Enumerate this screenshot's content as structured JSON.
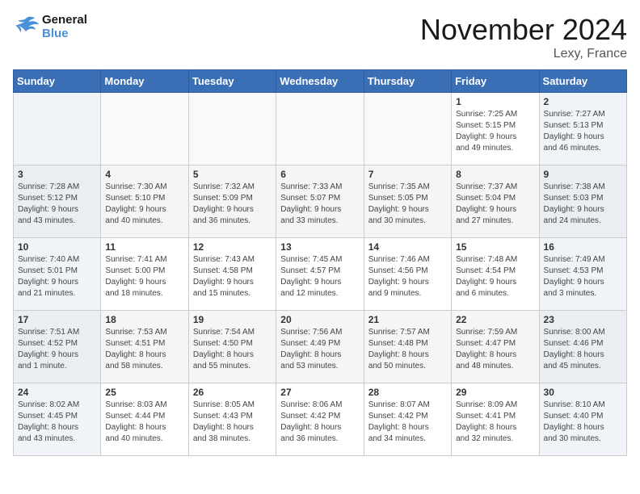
{
  "header": {
    "logo_line1": "General",
    "logo_line2": "Blue",
    "month": "November 2024",
    "location": "Lexy, France"
  },
  "days_of_week": [
    "Sunday",
    "Monday",
    "Tuesday",
    "Wednesday",
    "Thursday",
    "Friday",
    "Saturday"
  ],
  "weeks": [
    [
      {
        "day": "",
        "info": ""
      },
      {
        "day": "",
        "info": ""
      },
      {
        "day": "",
        "info": ""
      },
      {
        "day": "",
        "info": ""
      },
      {
        "day": "",
        "info": ""
      },
      {
        "day": "1",
        "info": "Sunrise: 7:25 AM\nSunset: 5:15 PM\nDaylight: 9 hours\nand 49 minutes."
      },
      {
        "day": "2",
        "info": "Sunrise: 7:27 AM\nSunset: 5:13 PM\nDaylight: 9 hours\nand 46 minutes."
      }
    ],
    [
      {
        "day": "3",
        "info": "Sunrise: 7:28 AM\nSunset: 5:12 PM\nDaylight: 9 hours\nand 43 minutes."
      },
      {
        "day": "4",
        "info": "Sunrise: 7:30 AM\nSunset: 5:10 PM\nDaylight: 9 hours\nand 40 minutes."
      },
      {
        "day": "5",
        "info": "Sunrise: 7:32 AM\nSunset: 5:09 PM\nDaylight: 9 hours\nand 36 minutes."
      },
      {
        "day": "6",
        "info": "Sunrise: 7:33 AM\nSunset: 5:07 PM\nDaylight: 9 hours\nand 33 minutes."
      },
      {
        "day": "7",
        "info": "Sunrise: 7:35 AM\nSunset: 5:05 PM\nDaylight: 9 hours\nand 30 minutes."
      },
      {
        "day": "8",
        "info": "Sunrise: 7:37 AM\nSunset: 5:04 PM\nDaylight: 9 hours\nand 27 minutes."
      },
      {
        "day": "9",
        "info": "Sunrise: 7:38 AM\nSunset: 5:03 PM\nDaylight: 9 hours\nand 24 minutes."
      }
    ],
    [
      {
        "day": "10",
        "info": "Sunrise: 7:40 AM\nSunset: 5:01 PM\nDaylight: 9 hours\nand 21 minutes."
      },
      {
        "day": "11",
        "info": "Sunrise: 7:41 AM\nSunset: 5:00 PM\nDaylight: 9 hours\nand 18 minutes."
      },
      {
        "day": "12",
        "info": "Sunrise: 7:43 AM\nSunset: 4:58 PM\nDaylight: 9 hours\nand 15 minutes."
      },
      {
        "day": "13",
        "info": "Sunrise: 7:45 AM\nSunset: 4:57 PM\nDaylight: 9 hours\nand 12 minutes."
      },
      {
        "day": "14",
        "info": "Sunrise: 7:46 AM\nSunset: 4:56 PM\nDaylight: 9 hours\nand 9 minutes."
      },
      {
        "day": "15",
        "info": "Sunrise: 7:48 AM\nSunset: 4:54 PM\nDaylight: 9 hours\nand 6 minutes."
      },
      {
        "day": "16",
        "info": "Sunrise: 7:49 AM\nSunset: 4:53 PM\nDaylight: 9 hours\nand 3 minutes."
      }
    ],
    [
      {
        "day": "17",
        "info": "Sunrise: 7:51 AM\nSunset: 4:52 PM\nDaylight: 9 hours\nand 1 minute."
      },
      {
        "day": "18",
        "info": "Sunrise: 7:53 AM\nSunset: 4:51 PM\nDaylight: 8 hours\nand 58 minutes."
      },
      {
        "day": "19",
        "info": "Sunrise: 7:54 AM\nSunset: 4:50 PM\nDaylight: 8 hours\nand 55 minutes."
      },
      {
        "day": "20",
        "info": "Sunrise: 7:56 AM\nSunset: 4:49 PM\nDaylight: 8 hours\nand 53 minutes."
      },
      {
        "day": "21",
        "info": "Sunrise: 7:57 AM\nSunset: 4:48 PM\nDaylight: 8 hours\nand 50 minutes."
      },
      {
        "day": "22",
        "info": "Sunrise: 7:59 AM\nSunset: 4:47 PM\nDaylight: 8 hours\nand 48 minutes."
      },
      {
        "day": "23",
        "info": "Sunrise: 8:00 AM\nSunset: 4:46 PM\nDaylight: 8 hours\nand 45 minutes."
      }
    ],
    [
      {
        "day": "24",
        "info": "Sunrise: 8:02 AM\nSunset: 4:45 PM\nDaylight: 8 hours\nand 43 minutes."
      },
      {
        "day": "25",
        "info": "Sunrise: 8:03 AM\nSunset: 4:44 PM\nDaylight: 8 hours\nand 40 minutes."
      },
      {
        "day": "26",
        "info": "Sunrise: 8:05 AM\nSunset: 4:43 PM\nDaylight: 8 hours\nand 38 minutes."
      },
      {
        "day": "27",
        "info": "Sunrise: 8:06 AM\nSunset: 4:42 PM\nDaylight: 8 hours\nand 36 minutes."
      },
      {
        "day": "28",
        "info": "Sunrise: 8:07 AM\nSunset: 4:42 PM\nDaylight: 8 hours\nand 34 minutes."
      },
      {
        "day": "29",
        "info": "Sunrise: 8:09 AM\nSunset: 4:41 PM\nDaylight: 8 hours\nand 32 minutes."
      },
      {
        "day": "30",
        "info": "Sunrise: 8:10 AM\nSunset: 4:40 PM\nDaylight: 8 hours\nand 30 minutes."
      }
    ]
  ]
}
